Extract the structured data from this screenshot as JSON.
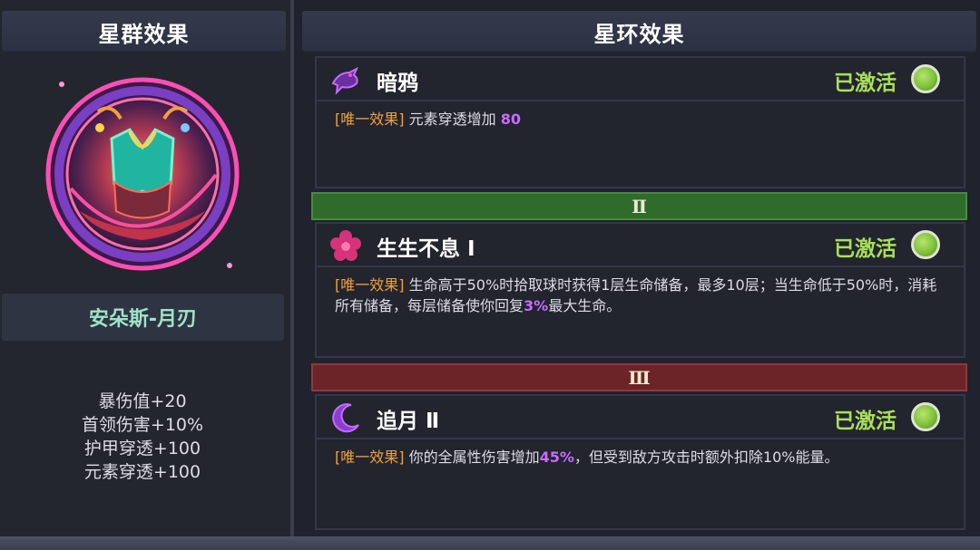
{
  "left": {
    "header": "星群效果",
    "constellation_name": "安朵斯-月刃",
    "stats": [
      "暴伤值+20",
      "首领伤害+10%",
      "护甲穿透+100",
      "元素穿透+100"
    ]
  },
  "right": {
    "header": "星环效果",
    "cards": [
      {
        "icon": "crow-icon",
        "title": "暗鸦",
        "status": "已激活",
        "tag": "[唯一效果]",
        "text_a": " 元素穿透增加 ",
        "highlight_a": "80",
        "text_b": "",
        "highlight_b": "",
        "text_c": ""
      },
      {
        "icon": "flower-icon",
        "title": "生生不息 Ⅰ",
        "status": "已激活",
        "tag": "[唯一效果]",
        "text_a": " 生命高于50%时拾取球时获得1层生命储备，最多10层；当生命低于50%时，消耗所有储备，每层储备使你回复",
        "highlight_a": "3%",
        "text_b": "最大生命。",
        "highlight_b": "",
        "text_c": ""
      },
      {
        "icon": "crescent-moon-icon",
        "title": "追月 Ⅱ",
        "status": "已激活",
        "tag": "[唯一效果]",
        "text_a": " 你的全属性伤害增加",
        "highlight_a": "45%",
        "text_b": "，但受到敌方攻击时额外扣除10%能量。",
        "highlight_b": "",
        "text_c": ""
      }
    ],
    "tiers": [
      "Ⅱ",
      "Ⅲ"
    ]
  },
  "colors": {
    "background": "#20222d",
    "active_status": "#a8e05a",
    "tag": "#f0a23c",
    "highlight": "#c76bff",
    "tier_2": "#2f6b2b",
    "tier_3": "#6c2428",
    "name_plate_text": "#9fe3c6"
  }
}
